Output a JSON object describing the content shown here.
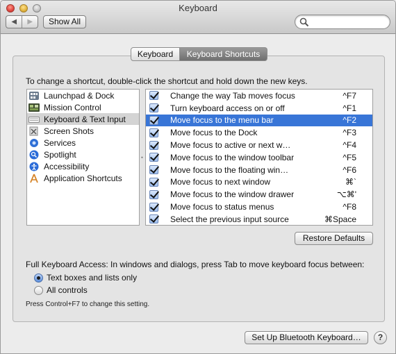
{
  "window": {
    "title": "Keyboard"
  },
  "toolbar": {
    "back_icon": "back-arrow",
    "forward_icon": "forward-arrow",
    "show_all_label": "Show All",
    "search_placeholder": ""
  },
  "tabs": [
    {
      "label": "Keyboard",
      "active": false
    },
    {
      "label": "Keyboard Shortcuts",
      "active": true
    }
  ],
  "instructions": "To change a shortcut, double-click the shortcut and hold down the new keys.",
  "categories": [
    {
      "label": "Launchpad & Dock",
      "icon": "launchpad-icon",
      "selected": false
    },
    {
      "label": "Mission Control",
      "icon": "mission-control-icon",
      "selected": false
    },
    {
      "label": "Keyboard & Text Input",
      "icon": "keyboard-icon",
      "selected": true
    },
    {
      "label": "Screen Shots",
      "icon": "screenshot-icon",
      "selected": false
    },
    {
      "label": "Services",
      "icon": "services-gear-icon",
      "selected": false
    },
    {
      "label": "Spotlight",
      "icon": "spotlight-icon",
      "selected": false
    },
    {
      "label": "Accessibility",
      "icon": "accessibility-icon",
      "selected": false
    },
    {
      "label": "Application Shortcuts",
      "icon": "app-shortcuts-icon",
      "selected": false
    }
  ],
  "shortcuts": [
    {
      "label": "Change the way Tab moves focus",
      "key": "^F7",
      "checked": true,
      "selected": false
    },
    {
      "label": "Turn keyboard access on or off",
      "key": "^F1",
      "checked": true,
      "selected": false
    },
    {
      "label": "Move focus to the menu bar",
      "key": "^F2",
      "checked": true,
      "selected": true
    },
    {
      "label": "Move focus to the Dock",
      "key": "^F3",
      "checked": true,
      "selected": false
    },
    {
      "label": "Move focus to active or next w…",
      "key": "^F4",
      "checked": true,
      "selected": false
    },
    {
      "label": "Move focus to the window toolbar",
      "key": "^F5",
      "checked": true,
      "selected": false
    },
    {
      "label": "Move focus to the floating win…",
      "key": "^F6",
      "checked": true,
      "selected": false
    },
    {
      "label": "Move focus to next window",
      "key": "⌘`",
      "checked": true,
      "selected": false
    },
    {
      "label": "Move focus to the window drawer",
      "key": "⌥⌘'",
      "checked": true,
      "selected": false
    },
    {
      "label": "Move focus to status menus",
      "key": "^F8",
      "checked": true,
      "selected": false
    },
    {
      "label": "Select the previous input source",
      "key": "⌘Space",
      "checked": true,
      "selected": false
    }
  ],
  "restore_defaults_label": "Restore Defaults",
  "full_keyboard_access": {
    "label": "Full Keyboard Access: In windows and dialogs, press Tab to move keyboard focus between:",
    "options": [
      {
        "label": "Text boxes and lists only",
        "selected": true
      },
      {
        "label": "All controls",
        "selected": false
      }
    ],
    "hint": "Press Control+F7 to change this setting."
  },
  "bluetooth_button_label": "Set Up Bluetooth Keyboard…",
  "help_label": "?",
  "colors": {
    "selection_blue": "#3875d7",
    "window_bg": "#ececec"
  }
}
